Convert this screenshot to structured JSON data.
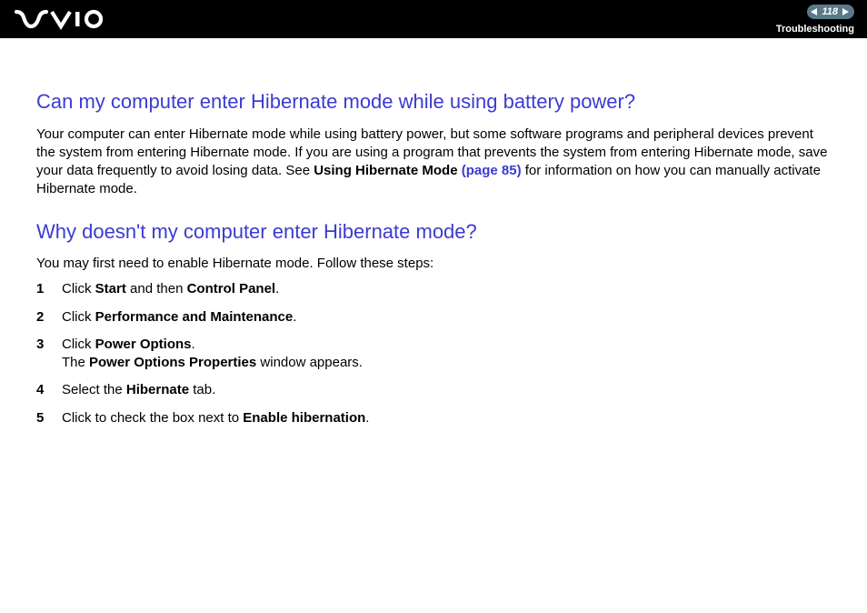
{
  "header": {
    "page_number": "118",
    "breadcrumb": "Troubleshooting"
  },
  "section1": {
    "heading": "Can my computer enter Hibernate mode while using battery power?",
    "para_pre": "Your computer can enter Hibernate mode while using battery power, but some software programs and peripheral devices prevent the system from entering Hibernate mode. If you are using a program that prevents the system from entering Hibernate mode, save your data frequently to avoid losing data. See ",
    "link_label": "Using Hibernate Mode",
    "link_page": "(page 85)",
    "para_post": " for information on how you can manually activate Hibernate mode."
  },
  "section2": {
    "heading": "Why doesn't my computer enter Hibernate mode?",
    "intro": "You may first need to enable Hibernate mode. Follow these steps:",
    "steps": [
      {
        "n": "1",
        "pre": "Click ",
        "b1": "Start",
        "mid": " and then ",
        "b2": "Control Panel",
        "post": "."
      },
      {
        "n": "2",
        "pre": "Click ",
        "b1": "Performance and Maintenance",
        "post": "."
      },
      {
        "n": "3",
        "pre": "Click ",
        "b1": "Power Options",
        "post": ".",
        "line2_pre": "The ",
        "line2_b": "Power Options Properties",
        "line2_post": " window appears."
      },
      {
        "n": "4",
        "pre": "Select the ",
        "b1": "Hibernate",
        "post": " tab."
      },
      {
        "n": "5",
        "pre": "Click to check the box next to ",
        "b1": "Enable hibernation",
        "post": "."
      }
    ]
  }
}
